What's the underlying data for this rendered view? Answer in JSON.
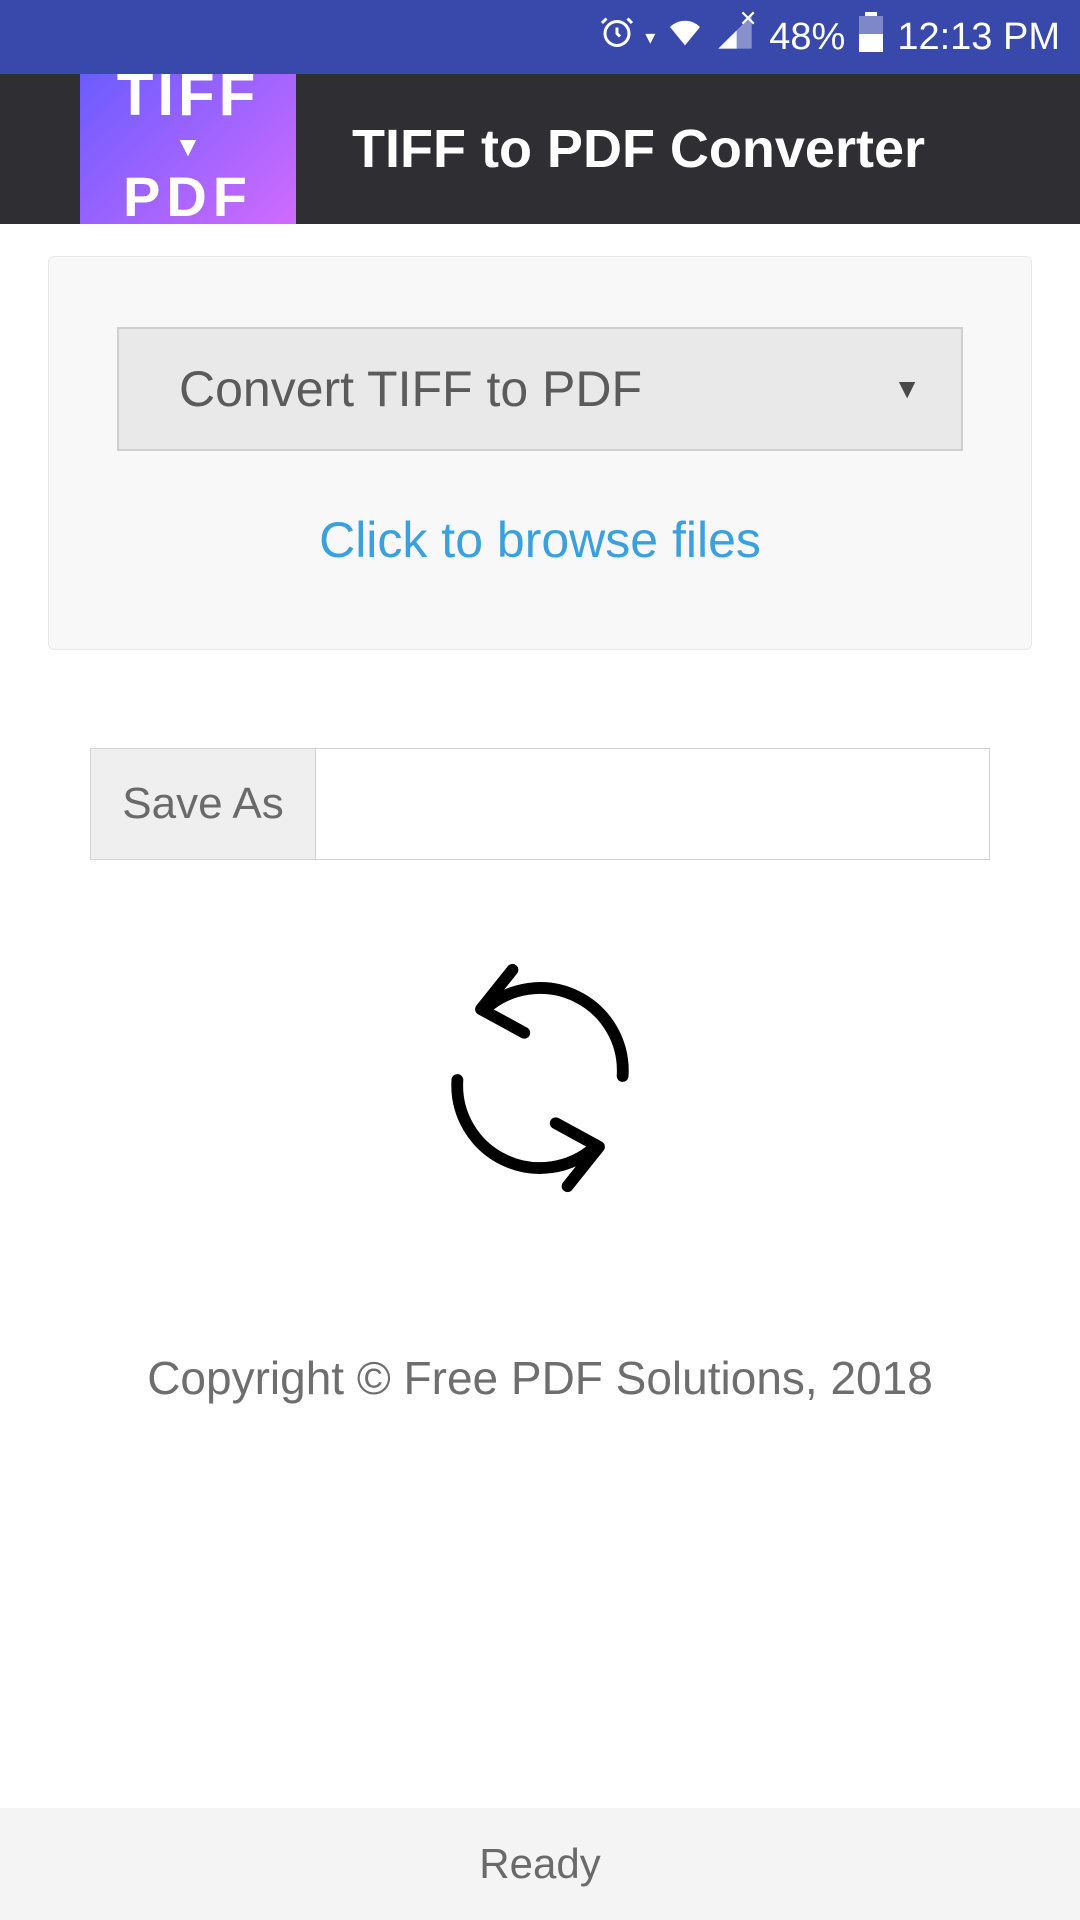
{
  "status_bar": {
    "battery_pct": "48%",
    "time": "12:13 PM"
  },
  "header": {
    "logo_top": "TIFF",
    "logo_bottom": "PDF",
    "title": "TIFF to PDF Converter"
  },
  "main": {
    "dropdown_selected": "Convert TIFF to PDF",
    "browse_label": "Click to browse files",
    "save_as_label": "Save As",
    "save_as_value": ""
  },
  "copyright": "Copyright © Free PDF Solutions, 2018",
  "footer": {
    "status": "Ready"
  }
}
